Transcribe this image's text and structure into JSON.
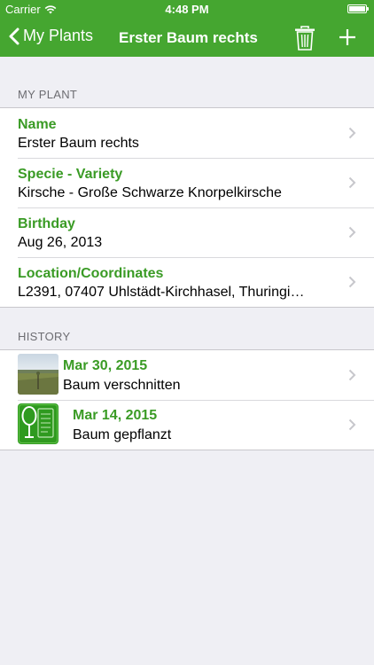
{
  "status_bar": {
    "carrier": "Carrier",
    "time": "4:48 PM",
    "battery_level": 1.0
  },
  "nav": {
    "back_label": "My Plants",
    "title": "Erster Baum rechts",
    "icons": [
      "chevron-left-icon",
      "trash-icon",
      "plus-icon"
    ]
  },
  "my_plant": {
    "header": "MY PLANT",
    "rows": [
      {
        "label": "Name",
        "value": "Erster Baum rechts"
      },
      {
        "label": "Specie - Variety",
        "value": "Kirsche - Große Schwarze Knorpelkirsche"
      },
      {
        "label": "Birthday",
        "value": "Aug 26, 2013"
      },
      {
        "label": "Location/Coordinates",
        "value": "L2391, 07407 Uhlstädt-Kirchhasel, Thuringi…"
      }
    ]
  },
  "history": {
    "header": "HISTORY",
    "entries": [
      {
        "date": "Mar 30, 2015",
        "note": "Baum verschnitten",
        "thumb_icon": "field-photo-icon"
      },
      {
        "date": "Mar 14, 2015",
        "note": "Baum gepflanzt",
        "thumb_icon": "tree-document-icon"
      }
    ]
  },
  "colors": {
    "bar": "#45a630",
    "accent_text": "#3a9b25",
    "background": "#efeff4"
  }
}
